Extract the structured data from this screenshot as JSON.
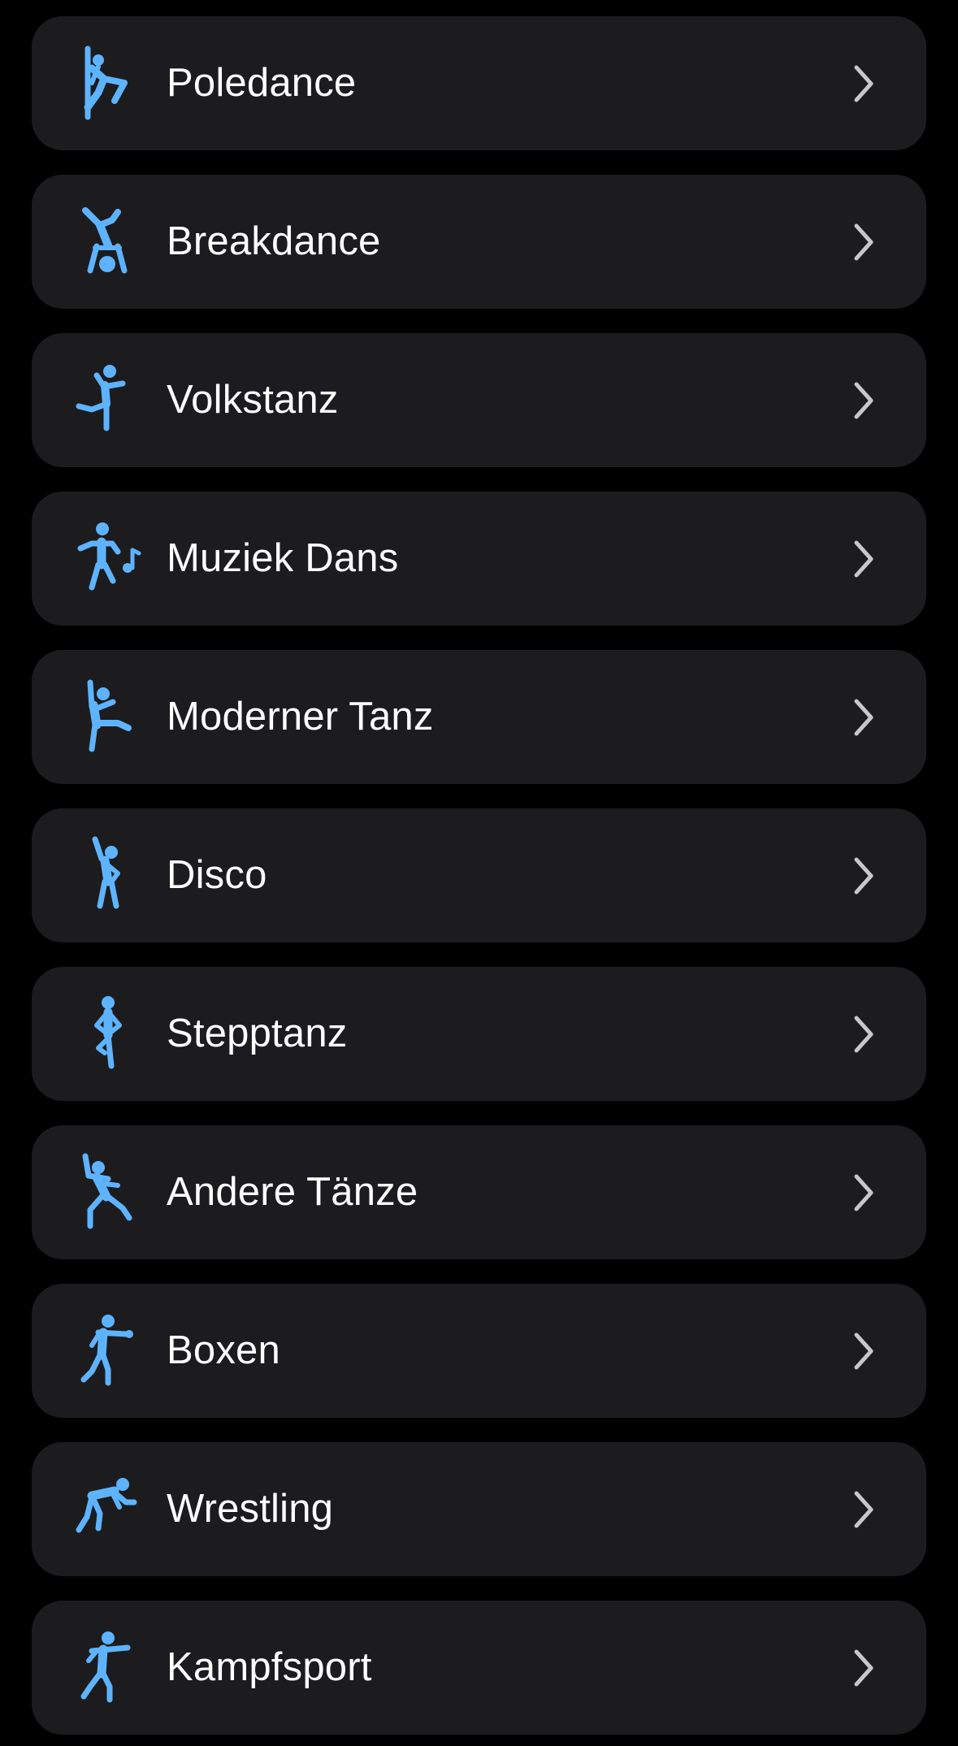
{
  "theme": {
    "accent": "#5eb3ff",
    "row_background": "#1c1c1e",
    "chevron_color": "#c7c7cc",
    "text_color": "#ffffff"
  },
  "activities": [
    {
      "label": "Poledance",
      "icon": "pole-dance-icon"
    },
    {
      "label": "Breakdance",
      "icon": "breakdance-icon"
    },
    {
      "label": "Volkstanz",
      "icon": "folk-dance-icon"
    },
    {
      "label": "Muziek Dans",
      "icon": "music-dance-icon"
    },
    {
      "label": "Moderner Tanz",
      "icon": "modern-dance-icon"
    },
    {
      "label": "Disco",
      "icon": "disco-icon"
    },
    {
      "label": "Stepptanz",
      "icon": "tap-dance-icon"
    },
    {
      "label": "Andere Tänze",
      "icon": "other-dance-icon"
    },
    {
      "label": "Boxen",
      "icon": "boxing-icon"
    },
    {
      "label": "Wrestling",
      "icon": "wrestling-icon"
    },
    {
      "label": "Kampfsport",
      "icon": "martial-arts-icon"
    }
  ]
}
